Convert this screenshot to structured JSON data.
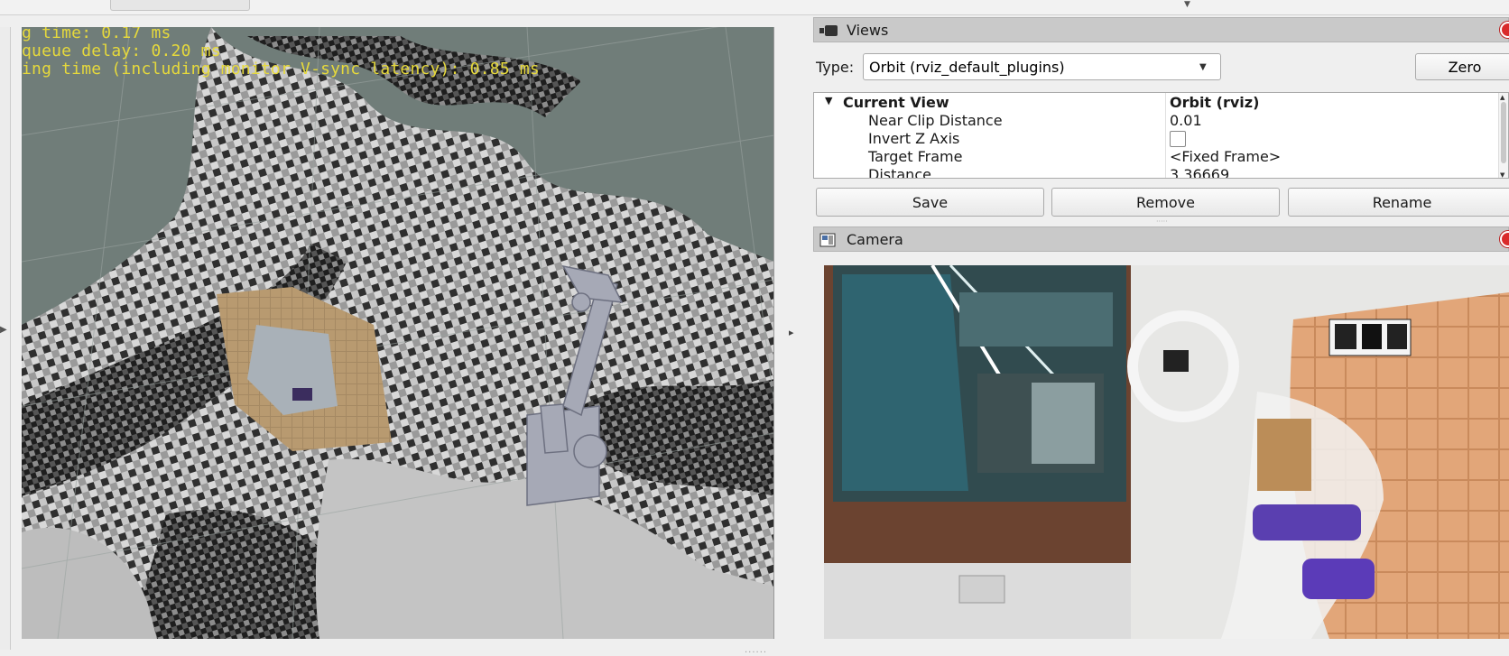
{
  "viewport": {
    "overlay_lines": [
      "g time: 0.17 ms",
      "queue delay: 0.20 ms",
      "ing time (including monitor V-sync latency): 0.85 ms"
    ]
  },
  "views": {
    "title": "Views",
    "type_label": "Type:",
    "type_value": "Orbit (rviz_default_plugins)",
    "zero_label": "Zero",
    "properties": [
      {
        "key": "Current View",
        "value": "Orbit (rviz)"
      },
      {
        "key": "Near Clip Distance",
        "value": "0.01"
      },
      {
        "key": "Invert Z Axis",
        "value": ""
      },
      {
        "key": "Target Frame",
        "value": "<Fixed Frame>"
      },
      {
        "key": "Distance",
        "value": "3.36669"
      }
    ],
    "buttons": {
      "save": "Save",
      "remove": "Remove",
      "rename": "Rename"
    }
  },
  "camera": {
    "title": "Camera"
  },
  "colors": {
    "overlay_text": "#e6d93c",
    "close_button": "#d92b2b",
    "title_bar": "#c9c9c9"
  },
  "icons": [
    "camera-views-icon",
    "camera-display-icon",
    "close-icon",
    "expand-triangle-icon",
    "dropdown-arrow-icon"
  ]
}
